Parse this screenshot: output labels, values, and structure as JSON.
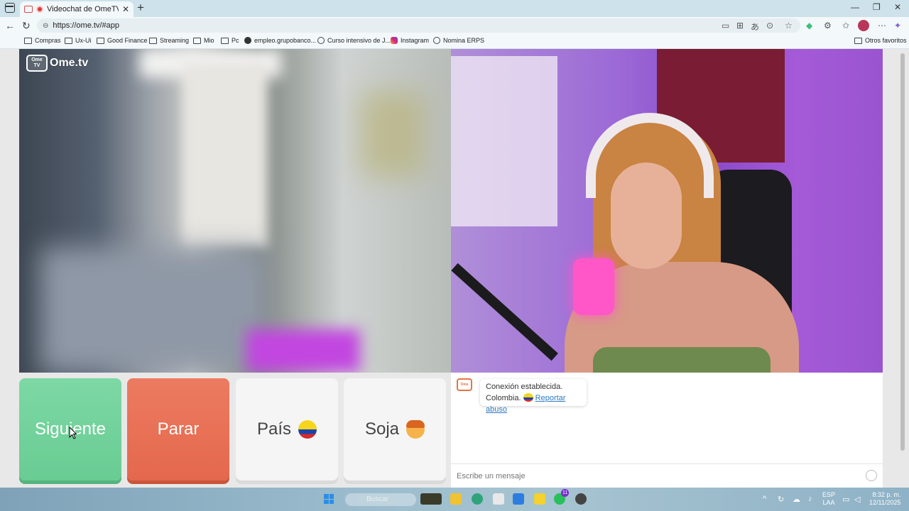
{
  "browser": {
    "tab_title": "Videochat de OmeTV — Alte",
    "url": "https://ome.tv/#app",
    "bookmarks": [
      "Compras",
      "Ux-Ui",
      "Good Finance",
      "Streaming",
      "Mio",
      "Pc",
      "empleo.grupobanco...",
      "Curso intensivo de J...",
      "Instagram",
      "Nomina ERPS"
    ],
    "other_bookmarks": "Otros favoritos"
  },
  "logo": {
    "tv_top": "Ome",
    "tv_bottom": "TV",
    "text": "Ome.tv"
  },
  "controls": {
    "next_label": "Siguiente",
    "stop_label": "Parar",
    "country_label": "País",
    "gender_label": "Soja"
  },
  "chat": {
    "logo_top": "Ome",
    "logo_bottom": "TV",
    "status": "Conexión establecida.",
    "country": "Colombia.",
    "report_label": "Reportar abuso",
    "input_placeholder": "Escribe un mensaje"
  },
  "taskbar": {
    "search_label": "Buscar",
    "whatsapp_badge": "11",
    "lang_top": "ESP",
    "lang_bottom": "LAA",
    "time": "8:32 p. m.",
    "date": "12/11/2025"
  },
  "icons": {
    "flag": "colombia-flag-icon",
    "gender": "boy-face-icon",
    "emoji": "smiley-icon"
  },
  "colors": {
    "next": "#69cc93",
    "stop": "#e4684d",
    "link": "#2f7bbf",
    "brand": "#e57445"
  }
}
